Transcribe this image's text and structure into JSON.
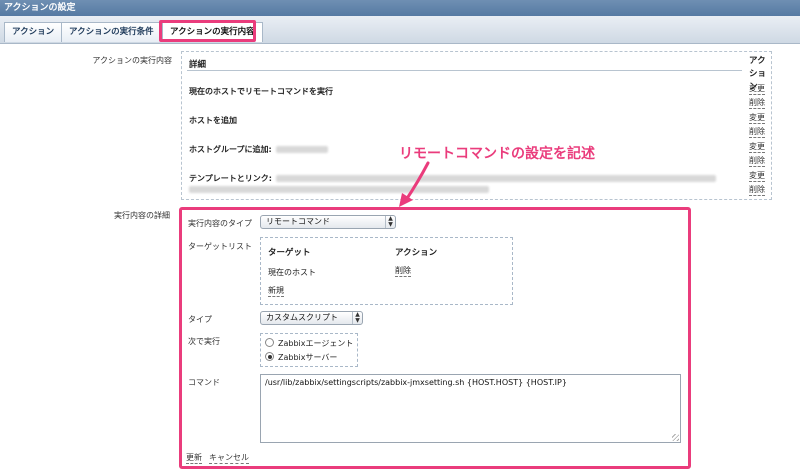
{
  "window": {
    "title": "アクションの設定"
  },
  "tabs": [
    {
      "label": "アクション"
    },
    {
      "label": "アクションの実行条件"
    },
    {
      "label": "アクションの実行内容"
    }
  ],
  "operations": {
    "section_label": "アクションの実行内容",
    "header_details": "詳細",
    "header_action": "アクション",
    "rows": [
      {
        "text": "現在のホストでリモートコマンドを実行",
        "edit": "変更",
        "delete": "削除"
      },
      {
        "text": "ホストを追加",
        "edit": "変更",
        "delete": "削除"
      },
      {
        "text": "ホストグループに追加:",
        "edit": "変更",
        "delete": "削除"
      },
      {
        "text": "テンプレートとリンク:",
        "edit": "変更",
        "delete": "削除"
      }
    ]
  },
  "detail": {
    "section_label": "実行内容の詳細",
    "op_type_label": "実行内容のタイプ",
    "op_type_value": "リモートコマンド",
    "target_list_label": "ターゲットリスト",
    "target_header": "ターゲット",
    "action_header": "アクション",
    "target_row": {
      "target": "現在のホスト",
      "action": "削除"
    },
    "new_link": "新規",
    "type_label": "タイプ",
    "type_value": "カスタムスクリプト",
    "execute_on_label": "次で実行",
    "execute_on_options": [
      {
        "label": "Zabbixエージェント",
        "selected": false
      },
      {
        "label": "Zabbixサーバー",
        "selected": true
      }
    ],
    "command_label": "コマンド",
    "command_value": "/usr/lib/zabbix/settingscripts/zabbix-jmxsetting.sh {HOST.HOST} {HOST.IP}",
    "update_link": "更新",
    "cancel_link": "キャンセル"
  },
  "annotation": {
    "callout_text": "リモートコマンドの設定を記述",
    "color": "#ea3c7c"
  }
}
